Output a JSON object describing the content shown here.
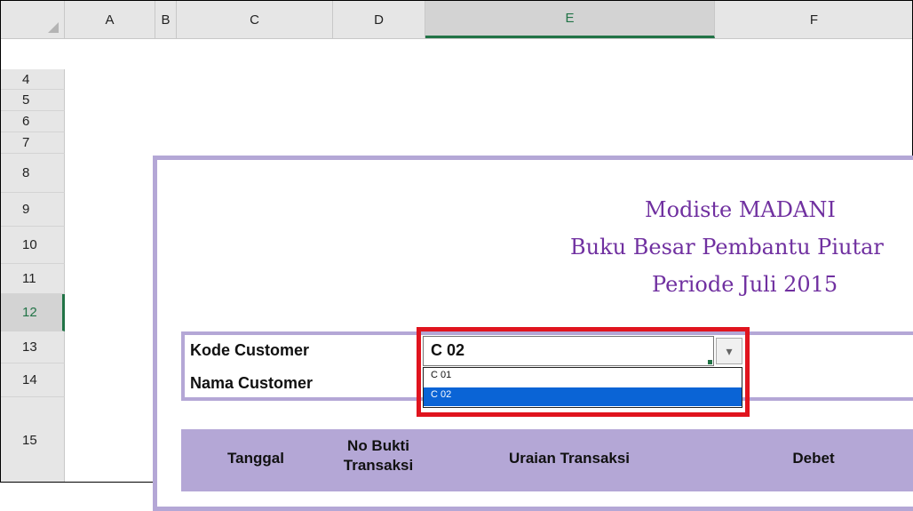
{
  "columns": [
    "A",
    "B",
    "C",
    "D",
    "E",
    "F"
  ],
  "selected_column": "E",
  "rows": [
    "4",
    "5",
    "6",
    "7",
    "8",
    "9",
    "10",
    "11",
    "12",
    "13",
    "14",
    "15"
  ],
  "selected_row": "12",
  "header": {
    "company": "Modiste MADANI",
    "report": "Buku Besar Pembantu Piutar",
    "period": "Periode Juli 2015"
  },
  "form": {
    "kode_label": "Kode  Customer",
    "nama_label": "Nama Customer",
    "kode_value": "C 02"
  },
  "dropdown": {
    "options": [
      "C 01",
      "C 02"
    ],
    "selected": "C 02"
  },
  "table": {
    "headers": [
      "Tanggal",
      "No Bukti\nTransaksi",
      "Uraian Transaksi",
      "Debet"
    ],
    "col_tanggal": "Tanggal",
    "col_bukti_1": "No Bukti",
    "col_bukti_2": "Transaksi",
    "col_uraian": "Uraian Transaksi",
    "col_debet": "Debet"
  },
  "colors": {
    "title": "#7030a0",
    "border": "#b4a7d6",
    "highlight": "#e0141e",
    "selection": "#0a64d6",
    "excel_green": "#217346"
  }
}
